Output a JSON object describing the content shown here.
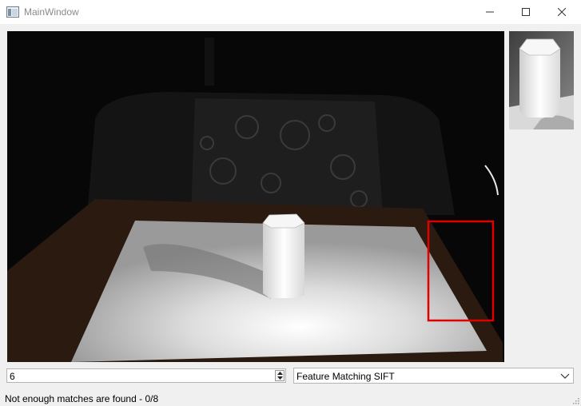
{
  "window": {
    "title": "MainWindow",
    "icons": [
      "app-icon",
      "minimize-icon",
      "maximize-icon",
      "close-icon"
    ]
  },
  "main_view": {
    "content": "scene image with red rectangle overlay",
    "overlay_color": "#e00000"
  },
  "thumbnail_view": {
    "content": "template image"
  },
  "controls": {
    "spin_value": "6",
    "method_selected": "Feature Matching SIFT"
  },
  "status": {
    "text": "Not enough matches are found - 0/8"
  },
  "colors": {
    "window_bg": "#f0f0f0",
    "titlebar_bg": "#ffffff",
    "overlay_red": "#e00000"
  }
}
